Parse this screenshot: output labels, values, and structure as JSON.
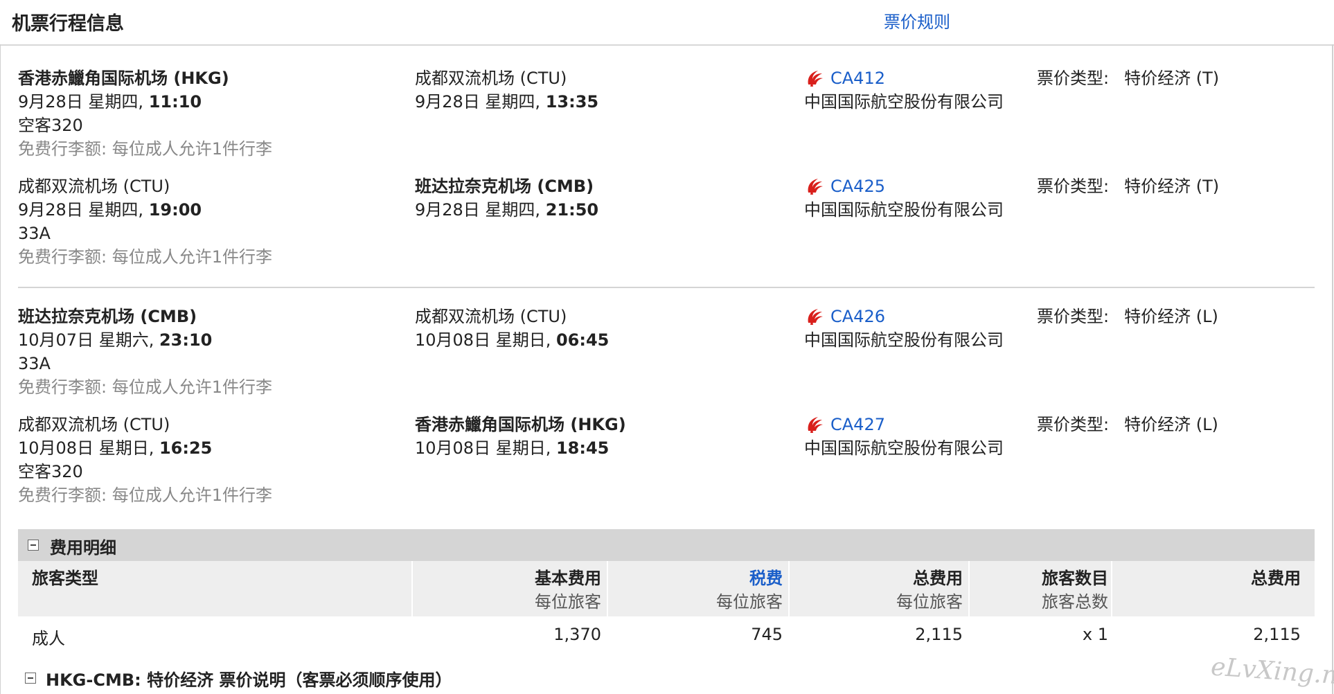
{
  "header": {
    "title": "机票行程信息",
    "fare_rules_link": "票价规则"
  },
  "segments": [
    {
      "depart": {
        "airport": "香港赤鱲角国际机场 (HKG)",
        "datetime_prefix": "9月28日 星期四, ",
        "time": "11:10",
        "aircraft": "空客320",
        "baggage": "免费行李额: 每位成人允许1件行李"
      },
      "arrive": {
        "airport": "成都双流机场 (CTU)",
        "datetime_prefix": "9月28日 星期四, ",
        "time": "13:35"
      },
      "flight": {
        "number": "CA412",
        "airline": "中国国际航空股份有限公司"
      },
      "fare": {
        "label": "票价类型:",
        "value": "特价经济 (T)"
      }
    },
    {
      "depart": {
        "airport": "成都双流机场 (CTU)",
        "datetime_prefix": "9月28日 星期四, ",
        "time": "19:00",
        "aircraft": "33A",
        "baggage": "免费行李额: 每位成人允许1件行李"
      },
      "arrive": {
        "airport": "班达拉奈克机场 (CMB)",
        "datetime_prefix": "9月28日 星期四, ",
        "time": "21:50"
      },
      "flight": {
        "number": "CA425",
        "airline": "中国国际航空股份有限公司"
      },
      "fare": {
        "label": "票价类型:",
        "value": "特价经济 (T)"
      }
    },
    {
      "depart": {
        "airport": "班达拉奈克机场 (CMB)",
        "datetime_prefix": "10月07日 星期六, ",
        "time": "23:10",
        "aircraft": "33A",
        "baggage": "免费行李额: 每位成人允许1件行李"
      },
      "arrive": {
        "airport": "成都双流机场 (CTU)",
        "datetime_prefix": "10月08日 星期日, ",
        "time": "06:45"
      },
      "flight": {
        "number": "CA426",
        "airline": "中国国际航空股份有限公司"
      },
      "fare": {
        "label": "票价类型:",
        "value": "特价经济 (L)"
      }
    },
    {
      "depart": {
        "airport": "成都双流机场 (CTU)",
        "datetime_prefix": "10月08日 星期日, ",
        "time": "16:25",
        "aircraft": "空客320",
        "baggage": "免费行李额: 每位成人允许1件行李"
      },
      "arrive": {
        "airport": "香港赤鱲角国际机场 (HKG)",
        "datetime_prefix": "10月08日 星期日, ",
        "time": "18:45"
      },
      "flight": {
        "number": "CA427",
        "airline": "中国国际航空股份有限公司"
      },
      "fare": {
        "label": "票价类型:",
        "value": "特价经济 (L)"
      }
    }
  ],
  "cost": {
    "section_title": "费用明细",
    "columns": {
      "passenger_type": "旅客类型",
      "base": {
        "title": "基本费用",
        "sub": "每位旅客"
      },
      "tax": {
        "title": "税费",
        "sub": "每位旅客"
      },
      "total_per": {
        "title": "总费用",
        "sub": "每位旅客"
      },
      "count": {
        "title": "旅客数目",
        "sub": "旅客总数"
      },
      "total": "总费用"
    },
    "row": {
      "type": "成人",
      "base": "1,370",
      "tax": "745",
      "total_per": "2,115",
      "count": "x 1",
      "total": "2,115"
    }
  },
  "fare_note": {
    "title": "HKG-CMB: 特价经济 票价说明（客票必须顺序使用）"
  },
  "watermark": "eLvXing.net",
  "colors": {
    "link": "#1a5ec9",
    "airline_logo": "#d9201c",
    "section_bg": "#d5d5d5",
    "table_header_bg": "#eeeeee"
  }
}
